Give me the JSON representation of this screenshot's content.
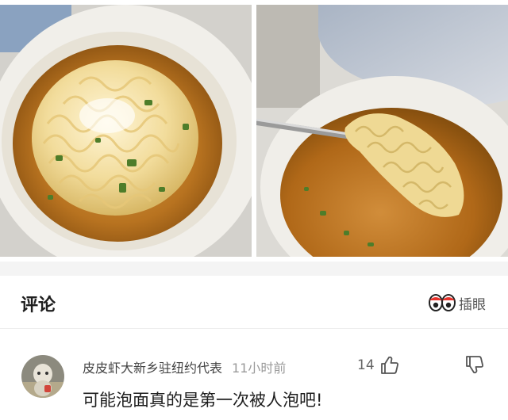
{
  "comments": {
    "title": "评论",
    "eyes_action_label": "插眼"
  },
  "comment": {
    "username": "皮皮虾大新乡驻纽约代表",
    "timestamp": "11小时前",
    "like_count": "14",
    "text": "可能泡面真的是第一次被人泡吧!"
  },
  "colors": {
    "accent_red": "#e8322b",
    "separator": "#f4f4f4",
    "muted_text": "#9a9a9a"
  },
  "icons": {
    "eyes": "eyes-icon",
    "like": "thumb-up-icon",
    "dislike": "thumb-down-icon"
  }
}
